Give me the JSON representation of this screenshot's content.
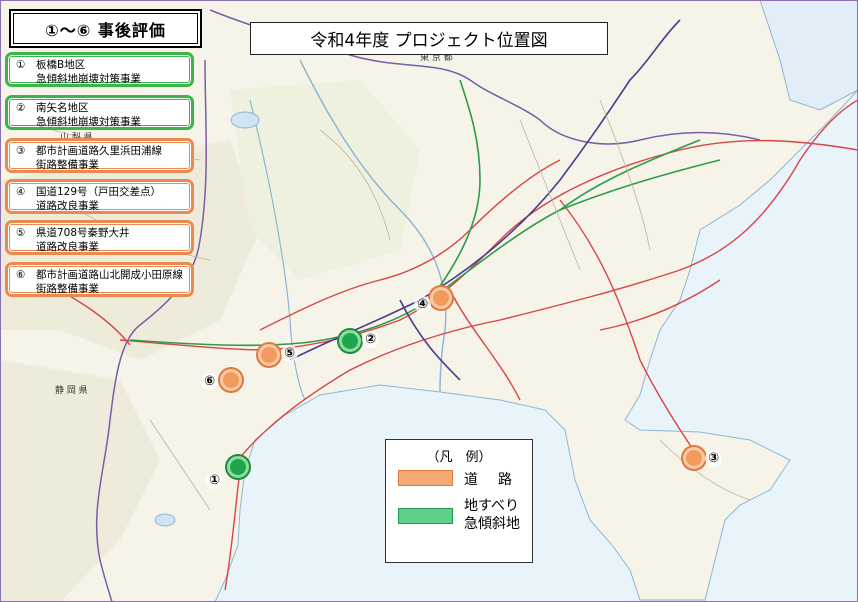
{
  "title": "①～⑥ 事後評価",
  "map_title": "令和4年度 プロジェクト位置図",
  "projects": [
    {
      "num": "①",
      "line1": "板橋B地区",
      "line2": "急傾斜地崩壊対策事業",
      "type": "green"
    },
    {
      "num": "②",
      "line1": "南矢名地区",
      "line2": "急傾斜地崩壊対策事業",
      "type": "green"
    },
    {
      "num": "③",
      "line1": "都市計画道路久里浜田浦線",
      "line2": "街路整備事業",
      "type": "orange"
    },
    {
      "num": "④",
      "line1": "国道129号（戸田交差点）",
      "line2": "道路改良事業",
      "type": "orange"
    },
    {
      "num": "⑤",
      "line1": "県道708号秦野大井",
      "line2": "道路改良事業",
      "type": "orange"
    },
    {
      "num": "⑥",
      "line1": "都市計画道路山北開成小田原線",
      "line2": "街路整備事業",
      "type": "orange"
    }
  ],
  "markers": [
    {
      "label": "①",
      "type": "green"
    },
    {
      "label": "②",
      "type": "green"
    },
    {
      "label": "③",
      "type": "orange"
    },
    {
      "label": "④",
      "type": "orange"
    },
    {
      "label": "⑤",
      "type": "orange"
    },
    {
      "label": "⑥",
      "type": "orange"
    }
  ],
  "legend": {
    "title": "（凡　例）",
    "road": "道路",
    "slope_line1": "地すべり",
    "slope_line2": "急傾斜地"
  },
  "places": {
    "tokyo": "東 京 都",
    "shizuoka": "静 岡 県",
    "yamanashi": "山 梨 県"
  },
  "colors": {
    "green": "#3cb44b",
    "orange": "#ea8a50",
    "sea": "#e9f3fa",
    "land": "#f6f3e8"
  }
}
